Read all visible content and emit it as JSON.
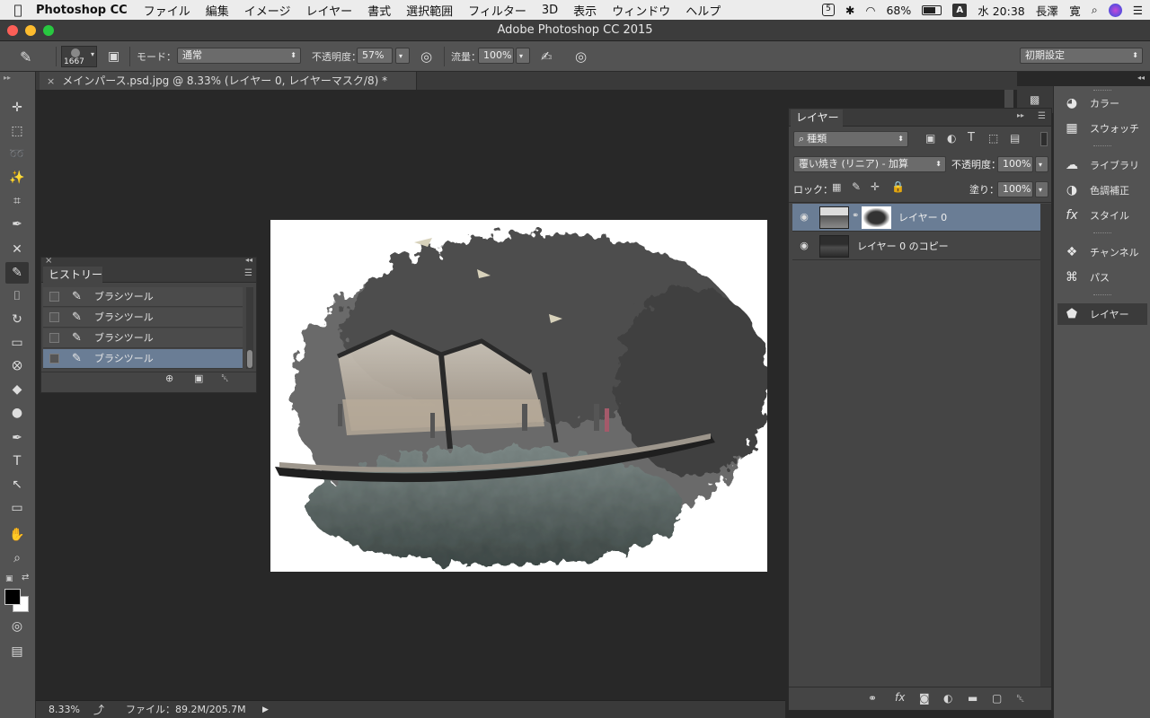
{
  "menubar": {
    "apple": "",
    "app": "Photoshop CC",
    "items": [
      "ファイル",
      "編集",
      "イメージ",
      "レイヤー",
      "書式",
      "選択範囲",
      "フィルター",
      "3D",
      "表示",
      "ウィンドウ",
      "ヘルプ"
    ],
    "right": {
      "badge": "5",
      "battery": "68%",
      "input": "A",
      "clock": "水 20:38",
      "user": "長澤　寛"
    }
  },
  "window": {
    "title": "Adobe Photoshop CC 2015"
  },
  "options": {
    "brush_size": "1667",
    "mode_label": "モード：",
    "mode_value": "通常",
    "opacity_label": "不透明度：",
    "opacity_value": "57%",
    "flow_label": "流量：",
    "flow_value": "100%",
    "workspace": "初期設定"
  },
  "document": {
    "tab_title": "メインパース.psd.jpg @ 8.33% (レイヤー 0, レイヤーマスク/8) *",
    "zoom": "8.33%",
    "file_info": "ファイル：89.2M/205.7M"
  },
  "history": {
    "title": "ヒストリー",
    "items": [
      "ブラシツール",
      "ブラシツール",
      "ブラシツール",
      "ブラシツール"
    ],
    "selected_index": 3
  },
  "layers": {
    "title": "レイヤー",
    "filter_label": "種類",
    "blend_mode": "覆い焼き (リニア) - 加算",
    "opacity_label": "不透明度：",
    "opacity_value": "100%",
    "lock_label": "ロック：",
    "fill_label": "塗り：",
    "fill_value": "100%",
    "items": [
      {
        "name": "レイヤー 0",
        "selected": true,
        "has_mask": true
      },
      {
        "name": "レイヤー 0 のコピー",
        "selected": false,
        "has_mask": false
      }
    ]
  },
  "dock": {
    "items": [
      "カラー",
      "スウォッチ",
      "ライブラリ",
      "色調補正",
      "スタイル",
      "チャンネル",
      "パス",
      "レイヤー"
    ],
    "selected": "レイヤー"
  },
  "colors": {
    "selection": "#6a7d95",
    "panel": "#454545",
    "chrome": "#535353",
    "workspace": "#282828"
  }
}
